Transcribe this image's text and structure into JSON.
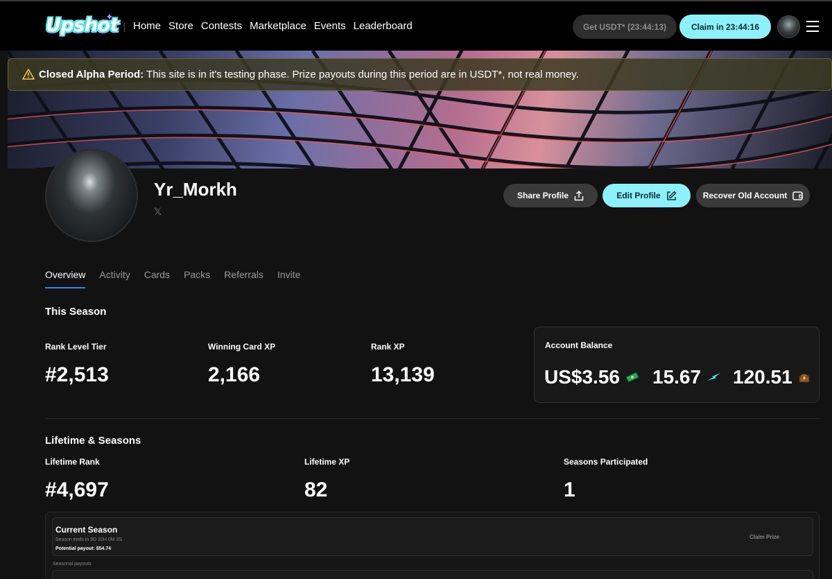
{
  "brand": {
    "logo_text": "Upshot"
  },
  "nav": {
    "items": [
      "Home",
      "Store",
      "Contests",
      "Marketplace",
      "Events",
      "Leaderboard"
    ],
    "get_usdt_label": "Get USDT* (23:44:13)",
    "claim_label": "Claim in 23:44:16"
  },
  "alert": {
    "title": "Closed Alpha Period:",
    "message": "This site is in it's testing phase. Prize payouts during this period are in USDT*, not real money."
  },
  "profile": {
    "username": "Yr_Morkh",
    "social_icon": "x-icon",
    "share_label": "Share Profile",
    "edit_label": "Edit Profile",
    "recover_label": "Recover Old Account"
  },
  "tabs": [
    {
      "label": "Overview",
      "active": true
    },
    {
      "label": "Activity",
      "active": false
    },
    {
      "label": "Cards",
      "active": false
    },
    {
      "label": "Packs",
      "active": false
    },
    {
      "label": "Referrals",
      "active": false
    },
    {
      "label": "Invite",
      "active": false
    }
  ],
  "season": {
    "title": "This Season",
    "rank_level_tier_label": "Rank Level Tier",
    "rank_level_tier": "#2,513",
    "winning_card_xp_label": "Winning Card XP",
    "winning_card_xp": "2,166",
    "rank_xp_label": "Rank XP",
    "rank_xp": "13,139"
  },
  "balance": {
    "label": "Account Balance",
    "usd": "US$3.56",
    "tokens": "15.67",
    "coins": "120.51"
  },
  "lifetime": {
    "title": "Lifetime & Seasons",
    "rank_label": "Lifetime Rank",
    "rank": "#4,697",
    "xp_label": "Lifetime XP",
    "xp": "82",
    "seasons_label": "Seasons Participated",
    "seasons": "1"
  },
  "current_season": {
    "title": "Current Season",
    "ends": "Season ends in 9D 20H 0M 3S",
    "payout": "Potential payout: $54.74",
    "claim_label": "Claim Prize",
    "seasonal_payouts_label": "Seasonal payouts"
  },
  "colors": {
    "accent": "#8ef0fb",
    "tab_underline": "#3b82f6",
    "alert_bg": "#3c3a22"
  }
}
